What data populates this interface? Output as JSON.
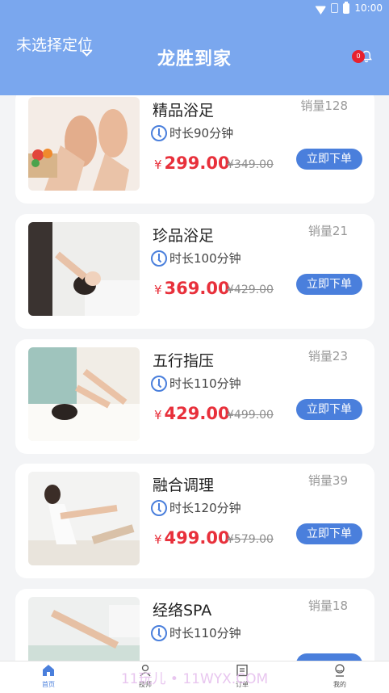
{
  "status_bar": {
    "time": "10:00"
  },
  "header": {
    "location": "未选择定位",
    "title": "龙胜到家",
    "badge_count": "0"
  },
  "products": [
    {
      "name": "精品浴足",
      "sales": "销量128",
      "duration": "时长90分钟",
      "price": "299.00",
      "original_price": "¥349.00",
      "order_label": "立即下单",
      "currency": "¥"
    },
    {
      "name": "珍品浴足",
      "sales": "销量21",
      "duration": "时长100分钟",
      "price": "369.00",
      "original_price": "¥429.00",
      "order_label": "立即下单",
      "currency": "¥"
    },
    {
      "name": "五行指压",
      "sales": "销量23",
      "duration": "时长110分钟",
      "price": "429.00",
      "original_price": "¥499.00",
      "order_label": "立即下单",
      "currency": "¥"
    },
    {
      "name": "融合调理",
      "sales": "销量39",
      "duration": "时长120分钟",
      "price": "499.00",
      "original_price": "¥579.00",
      "order_label": "立即下单",
      "currency": "¥"
    },
    {
      "name": "经络SPA",
      "sales": "销量18",
      "duration": "时长110分钟",
      "price": "",
      "original_price": "",
      "order_label": "",
      "currency": ""
    }
  ],
  "bottom_nav": [
    {
      "label": "首页",
      "icon": "home-icon",
      "active": true
    },
    {
      "label": "技师",
      "icon": "technician-icon",
      "active": false
    },
    {
      "label": "订单",
      "icon": "order-icon",
      "active": false
    },
    {
      "label": "我的",
      "icon": "profile-icon",
      "active": false
    }
  ],
  "watermark": "11玩儿 • 11WYX.COM",
  "colors": {
    "header": "#7aa7ee",
    "accent": "#4a7fdc",
    "price": "#e8303b",
    "badge": "#e8212e"
  }
}
